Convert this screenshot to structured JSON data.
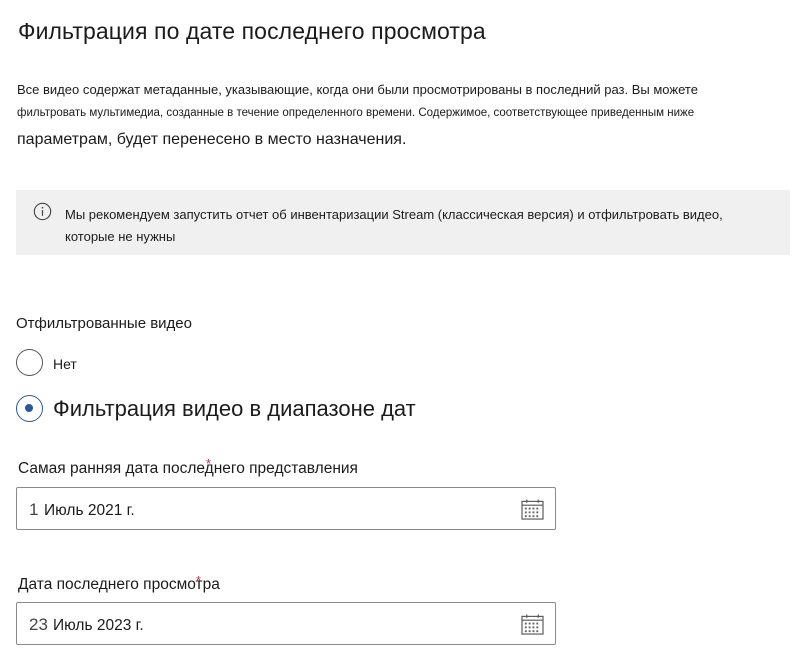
{
  "page": {
    "title": "Фильтрация по дате последнего просмотра",
    "description": {
      "line1": "Все видео содержат метаданные, указывающие, когда они были просмотрированы в последний раз. Вы можете",
      "line2": "фильтровать мультимедиа, созданные в течение определенного времени. Содержимое, соответствующее приведенным ниже",
      "line3": "параметрам, будет перенесено в место назначения."
    }
  },
  "info_banner": {
    "icon": "info-icon",
    "line1": "Мы рекомендуем запустить отчет об инвентаризации Stream (классическая версия) и отфильтровать видео,",
    "line2": "которые не нужны"
  },
  "filter": {
    "group_label": "Отфильтрованные видео",
    "options": [
      {
        "label": "Нет",
        "selected": false
      },
      {
        "label": "Фильтрация видео в диапазоне дат",
        "selected": true
      }
    ]
  },
  "fields": {
    "earliest": {
      "label": "Самая ранняя дата последнего представления",
      "required_mark": "*",
      "day": "1",
      "rest": "Июль 2021 г.",
      "icon": "calendar-icon"
    },
    "latest": {
      "label": "Дата последнего просмотра",
      "required_mark": "*",
      "day": "23",
      "rest": "Июль 2023 г.",
      "icon": "calendar-icon"
    }
  },
  "colors": {
    "accent": "#2b579a",
    "required": "#c4314b",
    "banner_bg": "#f0f0f0"
  }
}
